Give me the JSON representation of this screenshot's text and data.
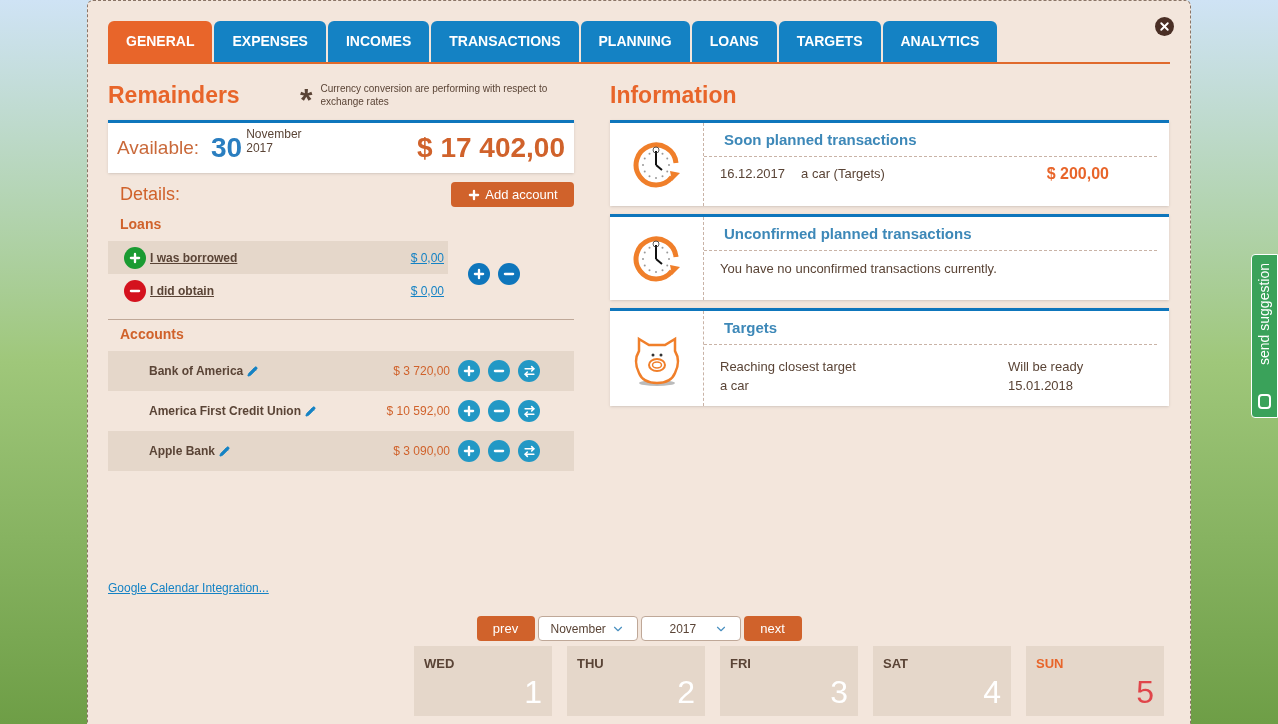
{
  "tabs": [
    {
      "label": "GENERAL",
      "selected": true
    },
    {
      "label": "EXPENSES",
      "selected": false
    },
    {
      "label": "INCOMES",
      "selected": false
    },
    {
      "label": "TRANSACTIONS",
      "selected": false
    },
    {
      "label": "PLANNING",
      "selected": false
    },
    {
      "label": "LOANS",
      "selected": false
    },
    {
      "label": "TARGETS",
      "selected": false
    },
    {
      "label": "ANALYTICS",
      "selected": false
    }
  ],
  "remainders": {
    "title": "Remainders",
    "note_mark": "*",
    "note": "Currency conversion are performing with respect to exchange rates",
    "available": {
      "label": "Available:",
      "day": "30",
      "month": "November",
      "year": "2017",
      "amount": "$ 17 402,00"
    },
    "details_label": "Details:",
    "add_account": "Add account",
    "loans": {
      "title": "Loans",
      "items": [
        {
          "kind": "borrowed",
          "label": "I was borrowed",
          "amount": "$ 0,00"
        },
        {
          "kind": "obtained",
          "label": "I did obtain",
          "amount": "$ 0,00"
        }
      ]
    },
    "accounts": {
      "title": "Accounts",
      "items": [
        {
          "name": "Bank of America",
          "amount": "$ 3 720,00"
        },
        {
          "name": "America First Credit Union",
          "amount": "$ 10 592,00"
        },
        {
          "name": "Apple Bank",
          "amount": "$ 3 090,00"
        }
      ]
    }
  },
  "information": {
    "title": "Information",
    "cards": [
      {
        "kind": "transactions",
        "title": "Soon planned transactions",
        "rows": [
          {
            "date": "16.12.2017",
            "description": "a car (Targets)",
            "amount": "$ 200,00"
          }
        ]
      },
      {
        "kind": "message",
        "title": "Unconfirmed planned transactions",
        "text": "You have no unconfirmed transactions currently."
      },
      {
        "kind": "target",
        "title": "Targets",
        "left_label": "Reaching closest target",
        "left_value": "a car",
        "right_label": "Will be ready",
        "right_value": "15.01.2018"
      }
    ]
  },
  "google_link": "Google Calendar Integration...",
  "calendar": {
    "prev": "prev",
    "month": "November",
    "year": "2017",
    "next": "next",
    "days": [
      {
        "kind": "blank"
      },
      {
        "kind": "blank"
      },
      {
        "kind": "day",
        "weekday": "WED",
        "day": "1",
        "weekend": false
      },
      {
        "kind": "day",
        "weekday": "THU",
        "day": "2",
        "weekend": false
      },
      {
        "kind": "day",
        "weekday": "FRI",
        "day": "3",
        "weekend": false
      },
      {
        "kind": "day",
        "weekday": "SAT",
        "day": "4",
        "weekend": false
      },
      {
        "kind": "day",
        "weekday": "SUN",
        "day": "5",
        "weekend": true
      }
    ]
  },
  "feedback_tab": {
    "label": "send suggestion"
  }
}
